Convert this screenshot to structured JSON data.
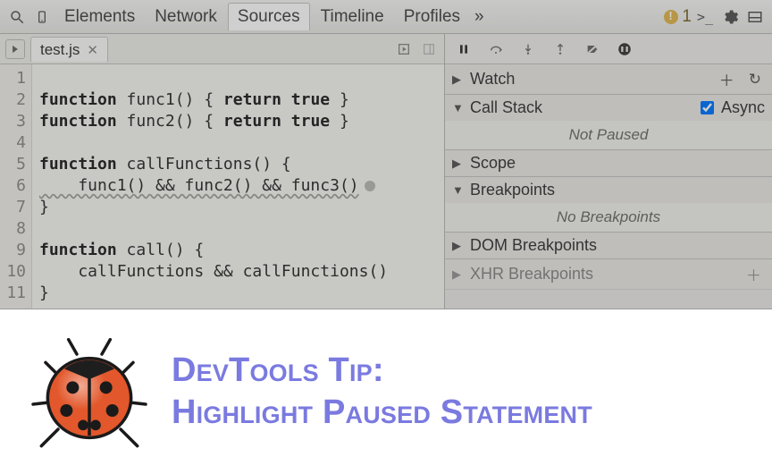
{
  "topbar": {
    "tabs": [
      "Elements",
      "Network",
      "Sources",
      "Timeline",
      "Profiles"
    ],
    "active_index": 2,
    "overflow_glyph": "»",
    "warning_count": "1",
    "console_glyph": ">_"
  },
  "file": {
    "name": "test.js"
  },
  "editor": {
    "lines": [
      {
        "n": 1,
        "raw": ""
      },
      {
        "n": 2,
        "raw": "function func1() { return true }"
      },
      {
        "n": 3,
        "raw": "function func2() { return true }"
      },
      {
        "n": 4,
        "raw": ""
      },
      {
        "n": 5,
        "raw": "function callFunctions() {"
      },
      {
        "n": 6,
        "raw": "    func1() && func2() && func3()",
        "squiggle": true,
        "dot": true
      },
      {
        "n": 7,
        "raw": "}"
      },
      {
        "n": 8,
        "raw": ""
      },
      {
        "n": 9,
        "raw": "function call() {"
      },
      {
        "n": 10,
        "raw": "    callFunctions && callFunctions()"
      },
      {
        "n": 11,
        "raw": "}"
      }
    ]
  },
  "debugger": {
    "sections": {
      "watch": {
        "label": "Watch",
        "expanded": false
      },
      "callstack": {
        "label": "Call Stack",
        "expanded": true,
        "async_label": "Async",
        "async_checked": true,
        "body": "Not Paused"
      },
      "scope": {
        "label": "Scope",
        "expanded": false
      },
      "breakpoints": {
        "label": "Breakpoints",
        "expanded": true,
        "body": "No Breakpoints"
      },
      "dom": {
        "label": "DOM Breakpoints",
        "expanded": false
      },
      "xhr": {
        "label": "XHR Breakpoints",
        "expanded": false
      }
    }
  },
  "caption": {
    "line1": "DevTools Tip:",
    "line2": "Highlight Paused Statement"
  }
}
